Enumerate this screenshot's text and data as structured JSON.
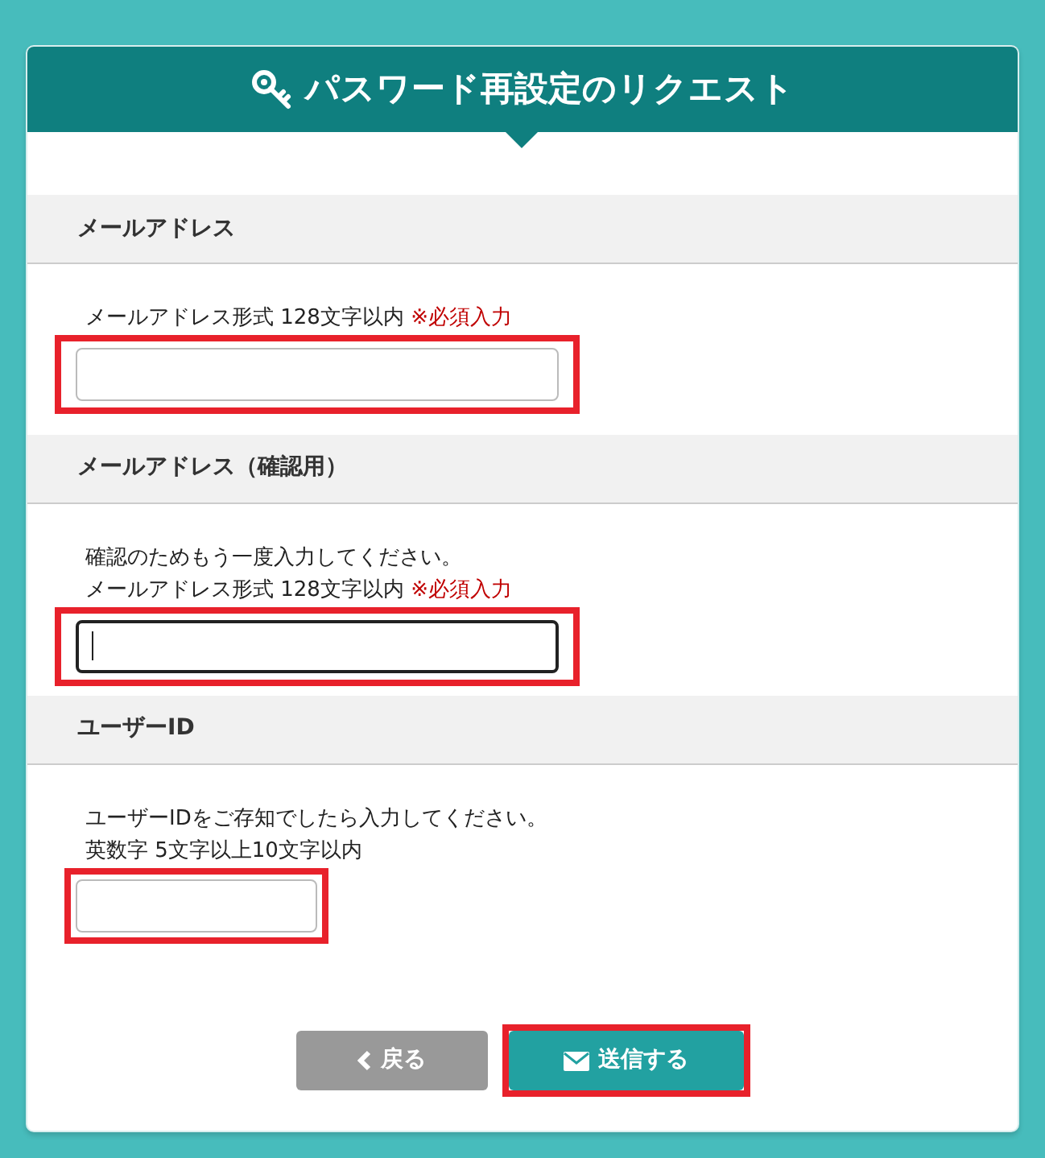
{
  "header": {
    "title": "パスワード再設定のリクエスト"
  },
  "sections": [
    {
      "label": "メールアドレス",
      "hints": [
        {
          "text": "メールアドレス形式 128文字以内",
          "note": "※必須入力"
        }
      ],
      "field": {
        "kind": "wide",
        "highlighted": true,
        "focused": false
      }
    },
    {
      "label": "メールアドレス（確認用）",
      "hints": [
        {
          "text": "確認のためもう一度入力してください。"
        },
        {
          "text": "メールアドレス形式 128文字以内",
          "note": "※必須入力"
        }
      ],
      "field": {
        "kind": "wide",
        "highlighted": true,
        "focused": true
      }
    },
    {
      "label": "ユーザーID",
      "hints": [
        {
          "text": "ユーザーIDをご存知でしたら入力してください。"
        },
        {
          "text": "英数字 5文字以上10文字以内"
        }
      ],
      "field": {
        "kind": "short",
        "highlighted": true,
        "focused": false
      }
    }
  ],
  "buttons": [
    {
      "label": "戻る",
      "kind": "back",
      "highlighted": false
    },
    {
      "label": "送信する",
      "kind": "submit",
      "highlighted": true
    }
  ]
}
